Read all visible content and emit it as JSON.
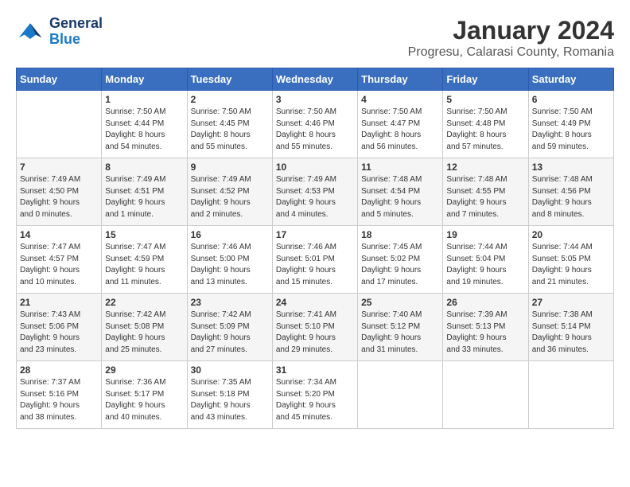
{
  "header": {
    "logo_line1": "General",
    "logo_line2": "Blue",
    "month": "January 2024",
    "location": "Progresu, Calarasi County, Romania"
  },
  "days_of_week": [
    "Sunday",
    "Monday",
    "Tuesday",
    "Wednesday",
    "Thursday",
    "Friday",
    "Saturday"
  ],
  "weeks": [
    [
      {
        "day": "",
        "info": ""
      },
      {
        "day": "1",
        "info": "Sunrise: 7:50 AM\nSunset: 4:44 PM\nDaylight: 8 hours\nand 54 minutes."
      },
      {
        "day": "2",
        "info": "Sunrise: 7:50 AM\nSunset: 4:45 PM\nDaylight: 8 hours\nand 55 minutes."
      },
      {
        "day": "3",
        "info": "Sunrise: 7:50 AM\nSunset: 4:46 PM\nDaylight: 8 hours\nand 55 minutes."
      },
      {
        "day": "4",
        "info": "Sunrise: 7:50 AM\nSunset: 4:47 PM\nDaylight: 8 hours\nand 56 minutes."
      },
      {
        "day": "5",
        "info": "Sunrise: 7:50 AM\nSunset: 4:48 PM\nDaylight: 8 hours\nand 57 minutes."
      },
      {
        "day": "6",
        "info": "Sunrise: 7:50 AM\nSunset: 4:49 PM\nDaylight: 8 hours\nand 59 minutes."
      }
    ],
    [
      {
        "day": "7",
        "info": "Sunrise: 7:49 AM\nSunset: 4:50 PM\nDaylight: 9 hours\nand 0 minutes."
      },
      {
        "day": "8",
        "info": "Sunrise: 7:49 AM\nSunset: 4:51 PM\nDaylight: 9 hours\nand 1 minute."
      },
      {
        "day": "9",
        "info": "Sunrise: 7:49 AM\nSunset: 4:52 PM\nDaylight: 9 hours\nand 2 minutes."
      },
      {
        "day": "10",
        "info": "Sunrise: 7:49 AM\nSunset: 4:53 PM\nDaylight: 9 hours\nand 4 minutes."
      },
      {
        "day": "11",
        "info": "Sunrise: 7:48 AM\nSunset: 4:54 PM\nDaylight: 9 hours\nand 5 minutes."
      },
      {
        "day": "12",
        "info": "Sunrise: 7:48 AM\nSunset: 4:55 PM\nDaylight: 9 hours\nand 7 minutes."
      },
      {
        "day": "13",
        "info": "Sunrise: 7:48 AM\nSunset: 4:56 PM\nDaylight: 9 hours\nand 8 minutes."
      }
    ],
    [
      {
        "day": "14",
        "info": "Sunrise: 7:47 AM\nSunset: 4:57 PM\nDaylight: 9 hours\nand 10 minutes."
      },
      {
        "day": "15",
        "info": "Sunrise: 7:47 AM\nSunset: 4:59 PM\nDaylight: 9 hours\nand 11 minutes."
      },
      {
        "day": "16",
        "info": "Sunrise: 7:46 AM\nSunset: 5:00 PM\nDaylight: 9 hours\nand 13 minutes."
      },
      {
        "day": "17",
        "info": "Sunrise: 7:46 AM\nSunset: 5:01 PM\nDaylight: 9 hours\nand 15 minutes."
      },
      {
        "day": "18",
        "info": "Sunrise: 7:45 AM\nSunset: 5:02 PM\nDaylight: 9 hours\nand 17 minutes."
      },
      {
        "day": "19",
        "info": "Sunrise: 7:44 AM\nSunset: 5:04 PM\nDaylight: 9 hours\nand 19 minutes."
      },
      {
        "day": "20",
        "info": "Sunrise: 7:44 AM\nSunset: 5:05 PM\nDaylight: 9 hours\nand 21 minutes."
      }
    ],
    [
      {
        "day": "21",
        "info": "Sunrise: 7:43 AM\nSunset: 5:06 PM\nDaylight: 9 hours\nand 23 minutes."
      },
      {
        "day": "22",
        "info": "Sunrise: 7:42 AM\nSunset: 5:08 PM\nDaylight: 9 hours\nand 25 minutes."
      },
      {
        "day": "23",
        "info": "Sunrise: 7:42 AM\nSunset: 5:09 PM\nDaylight: 9 hours\nand 27 minutes."
      },
      {
        "day": "24",
        "info": "Sunrise: 7:41 AM\nSunset: 5:10 PM\nDaylight: 9 hours\nand 29 minutes."
      },
      {
        "day": "25",
        "info": "Sunrise: 7:40 AM\nSunset: 5:12 PM\nDaylight: 9 hours\nand 31 minutes."
      },
      {
        "day": "26",
        "info": "Sunrise: 7:39 AM\nSunset: 5:13 PM\nDaylight: 9 hours\nand 33 minutes."
      },
      {
        "day": "27",
        "info": "Sunrise: 7:38 AM\nSunset: 5:14 PM\nDaylight: 9 hours\nand 36 minutes."
      }
    ],
    [
      {
        "day": "28",
        "info": "Sunrise: 7:37 AM\nSunset: 5:16 PM\nDaylight: 9 hours\nand 38 minutes."
      },
      {
        "day": "29",
        "info": "Sunrise: 7:36 AM\nSunset: 5:17 PM\nDaylight: 9 hours\nand 40 minutes."
      },
      {
        "day": "30",
        "info": "Sunrise: 7:35 AM\nSunset: 5:18 PM\nDaylight: 9 hours\nand 43 minutes."
      },
      {
        "day": "31",
        "info": "Sunrise: 7:34 AM\nSunset: 5:20 PM\nDaylight: 9 hours\nand 45 minutes."
      },
      {
        "day": "",
        "info": ""
      },
      {
        "day": "",
        "info": ""
      },
      {
        "day": "",
        "info": ""
      }
    ]
  ]
}
